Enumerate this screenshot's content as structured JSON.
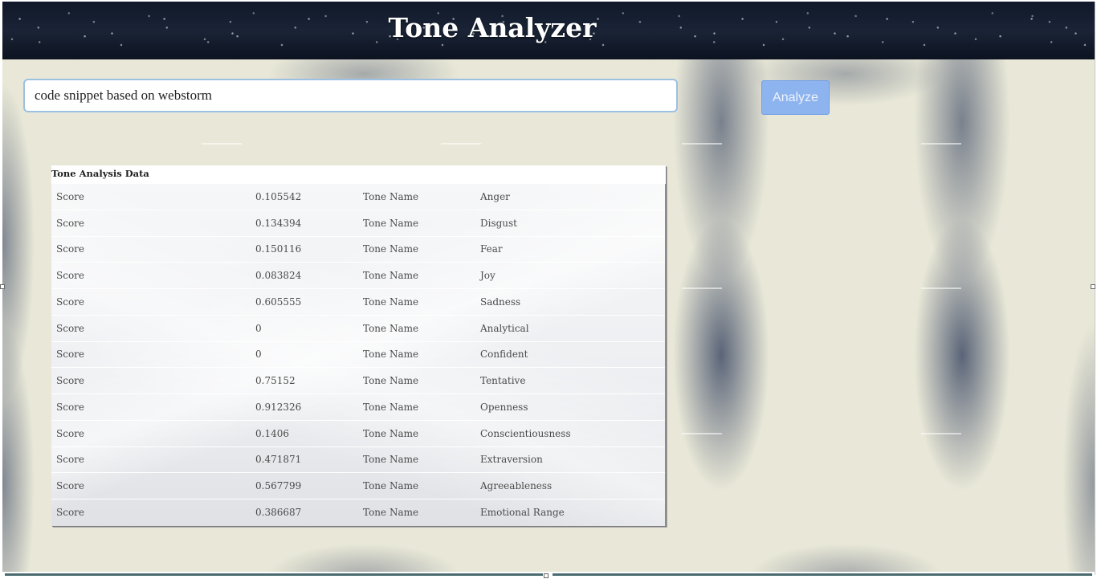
{
  "header": {
    "title": "Tone Analyzer"
  },
  "search": {
    "value": "code snippet based on webstorm"
  },
  "toolbar": {
    "analyze_label": "Analyze"
  },
  "table": {
    "caption": "Tone Analysis Data",
    "rows": [
      {
        "score_label": "Score",
        "score": "0.105542",
        "tone_label": "Tone Name",
        "tone": "Anger"
      },
      {
        "score_label": "Score",
        "score": "0.134394",
        "tone_label": "Tone Name",
        "tone": "Disgust"
      },
      {
        "score_label": "Score",
        "score": "0.150116",
        "tone_label": "Tone Name",
        "tone": "Fear"
      },
      {
        "score_label": "Score",
        "score": "0.083824",
        "tone_label": "Tone Name",
        "tone": "Joy"
      },
      {
        "score_label": "Score",
        "score": "0.605555",
        "tone_label": "Tone Name",
        "tone": "Sadness"
      },
      {
        "score_label": "Score",
        "score": "0",
        "tone_label": "Tone Name",
        "tone": "Analytical"
      },
      {
        "score_label": "Score",
        "score": "0",
        "tone_label": "Tone Name",
        "tone": "Confident"
      },
      {
        "score_label": "Score",
        "score": "0.75152",
        "tone_label": "Tone Name",
        "tone": "Tentative"
      },
      {
        "score_label": "Score",
        "score": "0.912326",
        "tone_label": "Tone Name",
        "tone": "Openness"
      },
      {
        "score_label": "Score",
        "score": "0.1406",
        "tone_label": "Tone Name",
        "tone": "Conscientiousness"
      },
      {
        "score_label": "Score",
        "score": "0.471871",
        "tone_label": "Tone Name",
        "tone": "Extraversion"
      },
      {
        "score_label": "Score",
        "score": "0.567799",
        "tone_label": "Tone Name",
        "tone": "Agreeableness"
      },
      {
        "score_label": "Score",
        "score": "0.386687",
        "tone_label": "Tone Name",
        "tone": "Emotional Range"
      }
    ]
  },
  "colors": {
    "header_bg": "#0d1322",
    "button_bg": "#8eb4ef",
    "input_border": "#9cc0e2"
  }
}
